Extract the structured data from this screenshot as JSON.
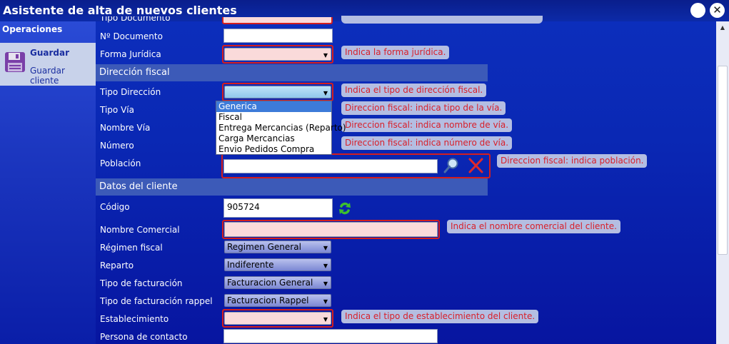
{
  "window": {
    "title": "Asistente de alta de nuevos clientes",
    "help_glyph": "",
    "close_glyph": "✕"
  },
  "sidebar": {
    "header": "Operaciones",
    "operation": {
      "title": "Guardar",
      "subtitle": "Guardar cliente",
      "icon": "floppy-disk-icon"
    }
  },
  "form": {
    "partial_hint": "...",
    "labels": {
      "tipo_documento": "Tipo Documento",
      "n_documento": "Nº Documento",
      "forma_juridica": "Forma Jurídica",
      "tipo_direccion": "Tipo Dirección",
      "tipo_via": "Tipo Vía",
      "nombre_via": "Nombre Vía",
      "numero": "Número",
      "poblacion": "Población",
      "codigo": "Código",
      "nombre_comercial": "Nombre Comercial",
      "regimen_fiscal": "Régimen fiscal",
      "reparto": "Reparto",
      "tipo_facturacion": "Tipo de facturación",
      "tipo_facturacion_rappel": "Tipo de facturación rappel",
      "establecimiento": "Establecimiento",
      "persona_contacto": "Persona de contacto"
    },
    "sections": {
      "direccion_fiscal": "Dirección fiscal",
      "datos_cliente": "Datos del cliente"
    },
    "values": {
      "codigo": "905724",
      "regimen_fiscal": "Regimen General",
      "reparto": "Indiferente",
      "tipo_facturacion": "Facturacion General",
      "tipo_facturacion_rappel": "Facturacion Rappel"
    },
    "hints": {
      "forma_juridica": "Indica la forma jurídica.",
      "tipo_direccion": "Indica el tipo de dirección fiscal.",
      "tipo_via": "Direccion fiscal: indica tipo de la vía.",
      "nombre_via": "Direccion fiscal: indica nombre de vía.",
      "numero": "Direccion fiscal: indica número de vía.",
      "poblacion": "Direccion fiscal: indica población.",
      "nombre_comercial": "Indica el nombre comercial del cliente.",
      "establecimiento": "Indica el tipo de establecimiento del cliente."
    },
    "tipo_direccion_options": [
      "Generica",
      "Fiscal",
      "Entrega Mercancias (Reparto)",
      "Carga Mercancias",
      "Envio Pedidos Compra"
    ],
    "tipo_direccion_highlighted": "Generica"
  },
  "icons": {
    "search": "magnifier-icon",
    "clear": "red-x-icon",
    "refresh": "green-refresh-icon"
  },
  "colors": {
    "hint_text": "#d8202a",
    "required_border": "#d41e1e",
    "section_bg": "#3c5ab8",
    "dropdown_highlight": "#3d7bd9"
  }
}
